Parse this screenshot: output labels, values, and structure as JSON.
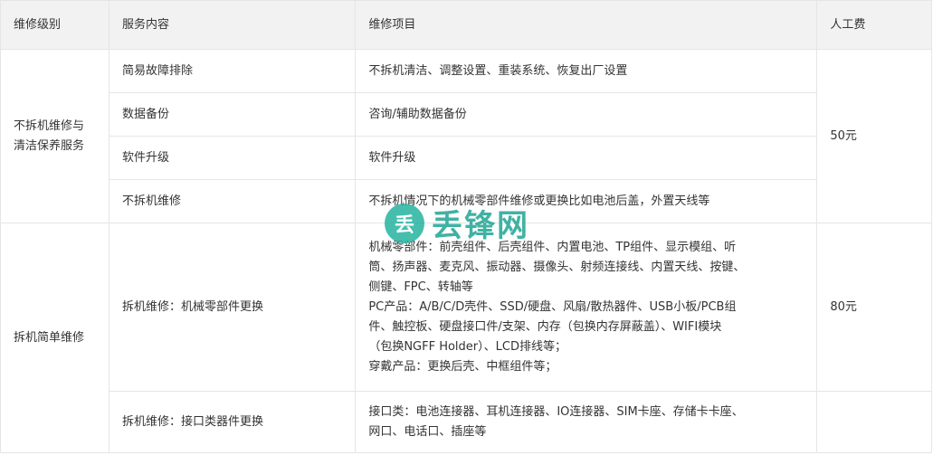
{
  "headers": {
    "level": "维修级别",
    "service": "服务内容",
    "items": "维修项目",
    "fee": "人工费"
  },
  "group1": {
    "level": "不拆机维修与清洁保养服务",
    "fee": "50元",
    "rows": [
      {
        "service": "简易故障排除",
        "items": "不拆机清洁、调整设置、重装系统、恢复出厂设置"
      },
      {
        "service": "数据备份",
        "items": "咨询/辅助数据备份"
      },
      {
        "service": "软件升级",
        "items": "软件升级"
      },
      {
        "service": "不拆机维修",
        "items": "不拆机情况下的机械零部件维修或更换比如电池后盖，外置天线等"
      }
    ]
  },
  "group2": {
    "level": "拆机简单维修",
    "row1": {
      "service": "拆机维修：机械零部件更换",
      "fee": "80元",
      "lines": [
        "机械零部件：前壳组件、后壳组件、内置电池、TP组件、显示模组、听",
        "筒、扬声器、麦克风、振动器、摄像头、射频连接线、内置天线、按键、",
        "侧键、FPC、转轴等",
        "PC产品：A/B/C/D壳件、SSD/硬盘、风扇/散热器件、USB小板/PCB组",
        "件、触控板、硬盘接口件/支架、内存（包换内存屏蔽盖）、WIFI模块",
        "（包换NGFF Holder）、LCD排线等；",
        "穿戴产品：更换后壳、中框组件等；"
      ]
    },
    "row2": {
      "service": "拆机维修：接口类器件更换",
      "fee": "",
      "lines": [
        "接口类：电池连接器、耳机连接器、IO连接器、SIM卡座、存储卡卡座、",
        "网口、电话口、插座等"
      ]
    }
  },
  "watermark": {
    "badge": "丢",
    "text": "丢锋网"
  }
}
